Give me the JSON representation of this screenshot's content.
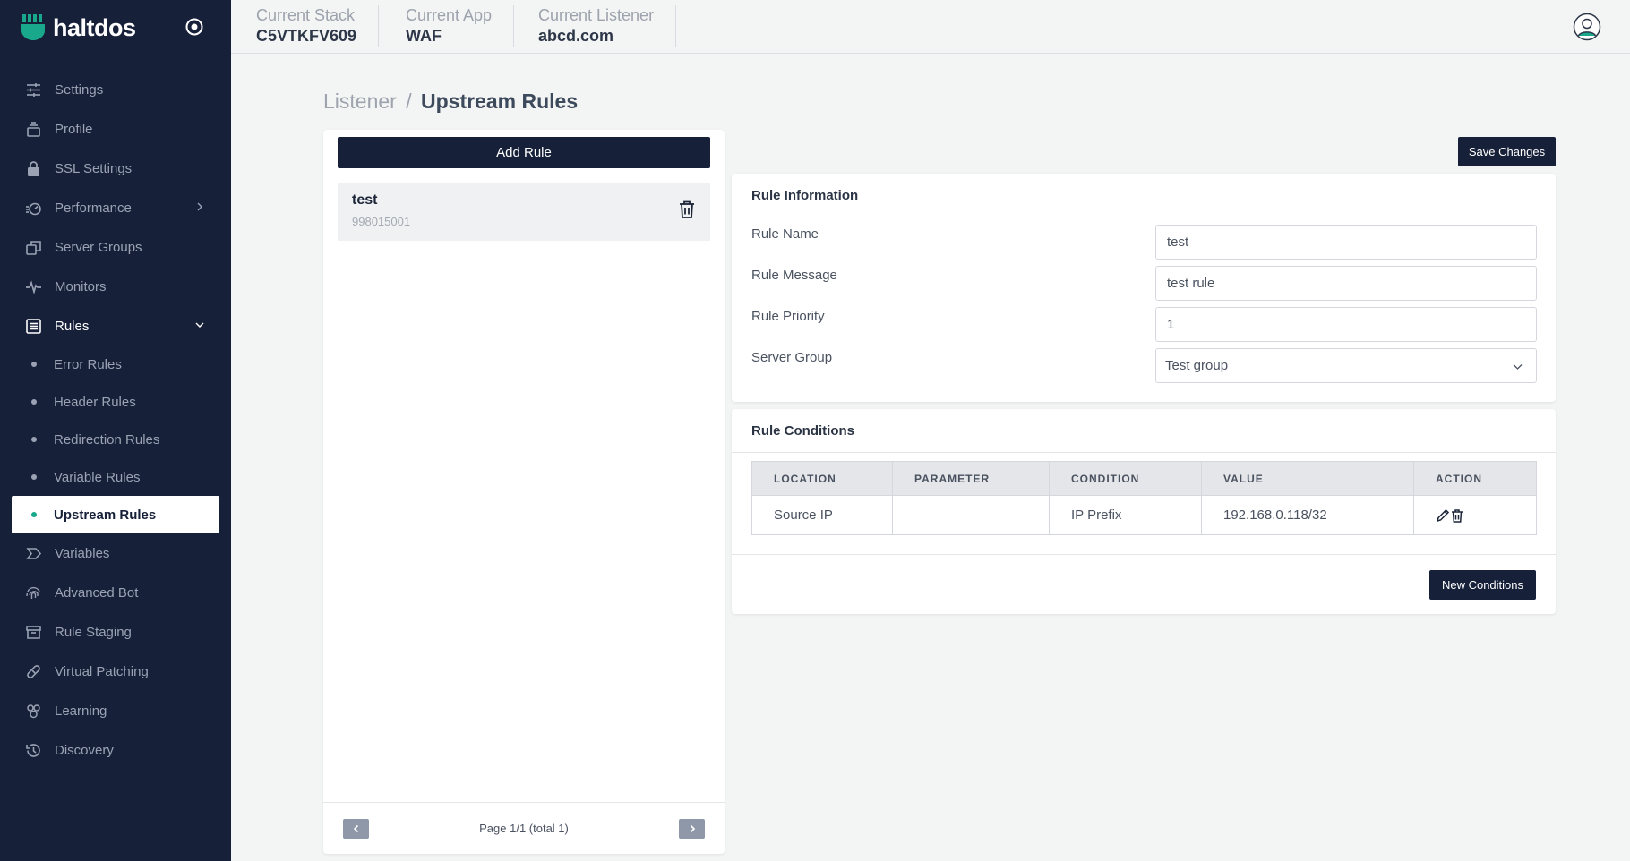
{
  "brand": {
    "name": "haltdos",
    "logo_icon": "haltdos-logo-icon",
    "accent": "#1aa88c"
  },
  "sidebar": {
    "background": "#172039",
    "items": [
      {
        "label": "Settings",
        "icon": "sliders-icon"
      },
      {
        "label": "Profile",
        "icon": "profile-stack-icon"
      },
      {
        "label": "SSL Settings",
        "icon": "lock-icon"
      },
      {
        "label": "Performance",
        "icon": "speedometer-icon",
        "has_submenu": true
      },
      {
        "label": "Server Groups",
        "icon": "server-groups-icon"
      },
      {
        "label": "Monitors",
        "icon": "pulse-icon"
      },
      {
        "label": "Rules",
        "icon": "list-icon",
        "expanded": true
      }
    ],
    "rules_subitems": [
      {
        "label": "Error Rules"
      },
      {
        "label": "Header Rules"
      },
      {
        "label": "Redirection Rules"
      },
      {
        "label": "Variable Rules"
      },
      {
        "label": "Upstream Rules",
        "active": true
      }
    ],
    "items_after": [
      {
        "label": "Variables",
        "icon": "tag-icon"
      },
      {
        "label": "Advanced Bot",
        "icon": "fingerprint-icon"
      },
      {
        "label": "Rule Staging",
        "icon": "archive-icon"
      },
      {
        "label": "Virtual Patching",
        "icon": "bandage-icon"
      },
      {
        "label": "Learning",
        "icon": "learning-icon"
      },
      {
        "label": "Discovery",
        "icon": "history-icon"
      }
    ]
  },
  "topbar": {
    "stack": {
      "label": "Current Stack",
      "value": "C5VTKFV609"
    },
    "app": {
      "label": "Current App",
      "value": "WAF"
    },
    "listener": {
      "label": "Current Listener",
      "value": "abcd.com"
    }
  },
  "breadcrumb": {
    "parent": "Listener",
    "separator": "/",
    "current": "Upstream Rules"
  },
  "rules_panel": {
    "add_label": "Add Rule",
    "rules": [
      {
        "name": "test",
        "id": "998015001"
      }
    ],
    "pagination": "Page 1/1 (total 1)"
  },
  "save_label": "Save Changes",
  "rule_info": {
    "title": "Rule Information",
    "fields": {
      "name": {
        "label": "Rule Name",
        "value": "test"
      },
      "message": {
        "label": "Rule Message",
        "value": "test rule"
      },
      "priority": {
        "label": "Rule Priority",
        "value": "1"
      },
      "server_group": {
        "label": "Server Group",
        "value": "Test group"
      }
    }
  },
  "rule_conditions": {
    "title": "Rule Conditions",
    "columns": [
      "LOCATION",
      "PARAMETER",
      "CONDITION",
      "VALUE",
      "ACTION"
    ],
    "rows": [
      {
        "location": "Source IP",
        "parameter": "",
        "condition": "IP Prefix",
        "value": "192.168.0.118/32"
      }
    ],
    "new_label": "New Conditions"
  }
}
